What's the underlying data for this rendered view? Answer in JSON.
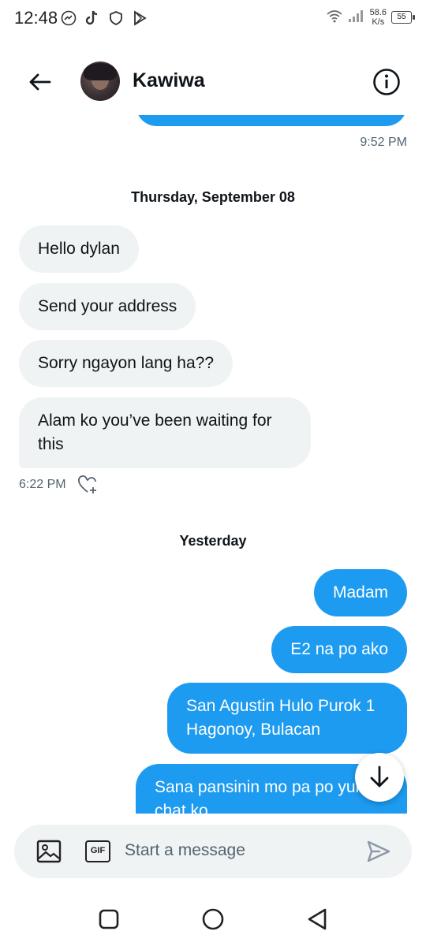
{
  "status_bar": {
    "time": "12:48",
    "net_speed_value": "58.6",
    "net_speed_unit": "K/s",
    "battery": "55",
    "icons": [
      "messenger-icon",
      "tiktok-icon",
      "shield-icon",
      "play-store-icon",
      "wifi-icon",
      "signal-icon",
      "battery-icon"
    ]
  },
  "header": {
    "contact_name": "Kawiwa",
    "back_icon": "arrow-left-icon",
    "info_icon": "info-circle-icon"
  },
  "chat": {
    "prev_timestamp": "9:52 PM",
    "sections": [
      {
        "day": "Thursday, September 08",
        "messages": [
          {
            "dir": "in",
            "text": "Hello dylan"
          },
          {
            "dir": "in",
            "text": "Send your address"
          },
          {
            "dir": "in",
            "text": "Sorry ngayon lang ha??"
          },
          {
            "dir": "in",
            "text_line1": "Alam ko you’ve been waiting for",
            "text_line2": "this"
          }
        ],
        "timestamp": "6:22 PM"
      },
      {
        "day": "Yesterday",
        "messages": [
          {
            "dir": "out",
            "text": "Madam"
          },
          {
            "dir": "out",
            "text": "E2 na po ako"
          },
          {
            "dir": "out",
            "text_line1": "San Agustin Hulo Purok 1",
            "text_line2": "Hagonoy, Bulacan"
          },
          {
            "dir": "out",
            "text_line1": "Sana pansinin mo pa po yung",
            "text_line2": "chat ko"
          }
        ]
      }
    ]
  },
  "composer": {
    "placeholder": "Start a message",
    "gif_label": "GIF"
  },
  "colors": {
    "accent": "#1d9bf0",
    "incoming_bubble": "#eff3f4",
    "muted_text": "#536471"
  }
}
